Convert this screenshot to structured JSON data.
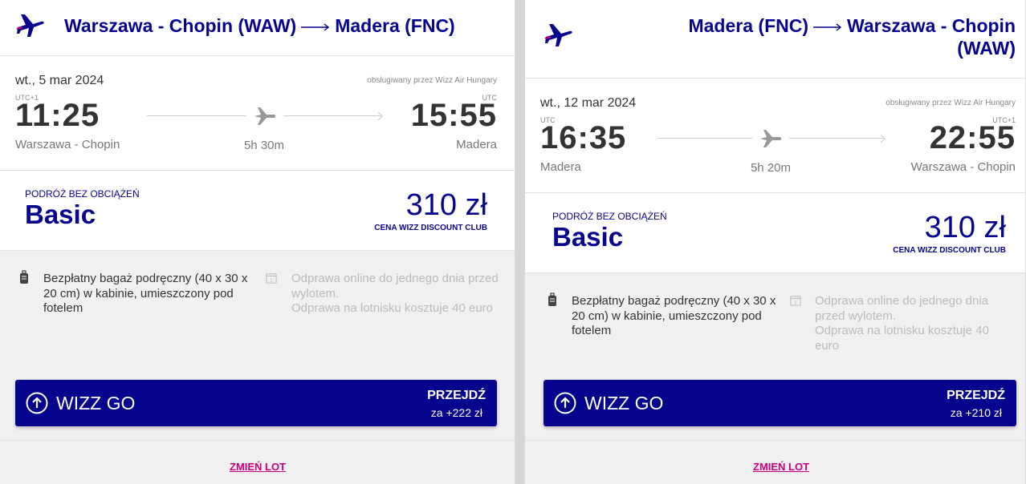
{
  "colors": {
    "brand_blue": "#06038d",
    "accent_pink": "#c6007e",
    "muted_text": "#777777"
  },
  "outbound": {
    "origin": "Warszawa - Chopin (WAW)",
    "destination": "Madera (FNC)",
    "date": "wt., 5 mar 2024",
    "operator": "obsługiwany przez Wizz Air Hungary",
    "dep_tz": "UTC+1",
    "arr_tz": "UTC",
    "dep_time": "11:25",
    "arr_time": "15:55",
    "dep_city": "Warszawa - Chopin",
    "arr_city": "Madera",
    "duration": "5h 30m",
    "fare_tag": "PODRÓŻ BEZ OBCIĄŻEŃ",
    "fare_name": "Basic",
    "price": "310 zł",
    "club": "CENA WIZZ DISCOUNT CLUB",
    "feature_bag": "Bezpłatny bagaż podręczny (40 x 30 x 20 cm) w kabinie, umieszczony pod fotelem",
    "feature_checkin_1": "Odprawa online do jednego dnia przed wylotem.",
    "feature_checkin_2": "Odprawa na lotnisku kosztuje 40 euro",
    "wizzgo_label": "WIZZ GO",
    "wizzgo_action": "PRZEJDŹ",
    "wizzgo_price": "za +222 zł",
    "change_label": "ZMIEŃ LOT"
  },
  "return": {
    "origin": "Madera (FNC)",
    "destination": "Warszawa - Chopin (WAW)",
    "date": "wt., 12 mar 2024",
    "operator": "obsługiwany przez Wizz Air Hungary",
    "dep_tz": "UTC",
    "arr_tz": "UTC+1",
    "dep_time": "16:35",
    "arr_time": "22:55",
    "dep_city": "Madera",
    "arr_city": "Warszawa - Chopin",
    "duration": "5h 20m",
    "fare_tag": "PODRÓŻ BEZ OBCIĄŻEŃ",
    "fare_name": "Basic",
    "price": "310 zł",
    "club": "CENA WIZZ DISCOUNT CLUB",
    "feature_bag": "Bezpłatny bagaż podręczny (40 x 30 x 20 cm) w kabinie, umieszczony pod fotelem",
    "feature_checkin_1": "Odprawa online do jednego dnia przed wylotem.",
    "feature_checkin_2": "Odprawa na lotnisku kosztuje 40 euro",
    "wizzgo_label": "WIZZ GO",
    "wizzgo_action": "PRZEJDŹ",
    "wizzgo_price": "za +210 zł",
    "change_label": "ZMIEŃ LOT"
  }
}
